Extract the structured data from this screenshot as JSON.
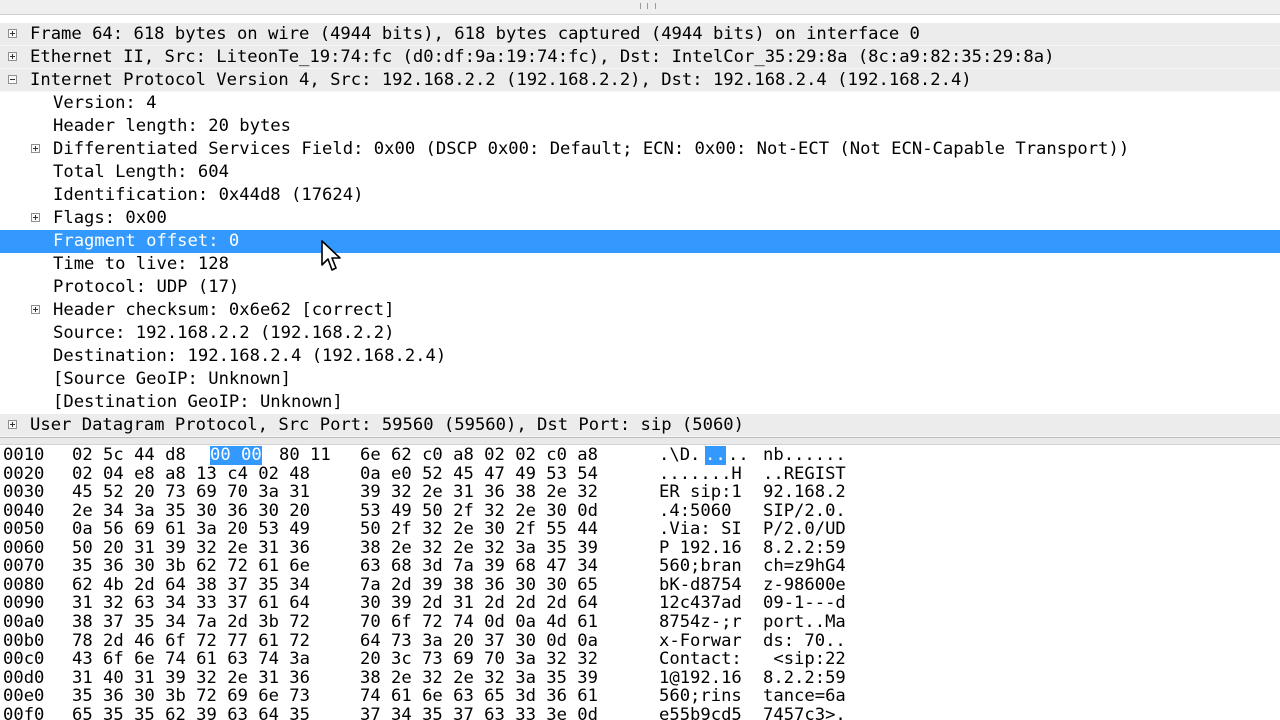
{
  "tree": {
    "rows": [
      {
        "label": "Frame 64: 618 bytes on wire (4944 bits), 618 bytes captured (4944 bits) on interface 0",
        "level": 0,
        "expander": "plus"
      },
      {
        "label": "Ethernet II, Src: LiteonTe_19:74:fc (d0:df:9a:19:74:fc), Dst: IntelCor_35:29:8a (8c:a9:82:35:29:8a)",
        "level": 0,
        "expander": "plus"
      },
      {
        "label": "Internet Protocol Version 4, Src: 192.168.2.2 (192.168.2.2), Dst: 192.168.2.4 (192.168.2.4)",
        "level": 0,
        "expander": "minus"
      },
      {
        "label": "Version: 4",
        "level": 1,
        "expander": "none"
      },
      {
        "label": "Header length: 20 bytes",
        "level": 1,
        "expander": "none"
      },
      {
        "label": "Differentiated Services Field: 0x00 (DSCP 0x00: Default; ECN: 0x00: Not-ECT (Not ECN-Capable Transport))",
        "level": 1,
        "expander": "plus"
      },
      {
        "label": "Total Length: 604",
        "level": 1,
        "expander": "none"
      },
      {
        "label": "Identification: 0x44d8 (17624)",
        "level": 1,
        "expander": "none"
      },
      {
        "label": "Flags: 0x00",
        "level": 1,
        "expander": "plus"
      },
      {
        "label": "Fragment offset: 0",
        "level": 1,
        "expander": "none",
        "selected": true
      },
      {
        "label": "Time to live: 128",
        "level": 1,
        "expander": "none"
      },
      {
        "label": "Protocol: UDP (17)",
        "level": 1,
        "expander": "none"
      },
      {
        "label": "Header checksum: 0x6e62 [correct]",
        "level": 1,
        "expander": "plus"
      },
      {
        "label": "Source: 192.168.2.2 (192.168.2.2)",
        "level": 1,
        "expander": "none"
      },
      {
        "label": "Destination: 192.168.2.4 (192.168.2.4)",
        "level": 1,
        "expander": "none"
      },
      {
        "label": "[Source GeoIP: Unknown]",
        "level": 1,
        "expander": "none"
      },
      {
        "label": "[Destination GeoIP: Unknown]",
        "level": 1,
        "expander": "none"
      },
      {
        "label": "User Datagram Protocol, Src Port: 59560 (59560), Dst Port: sip (5060)",
        "level": 0,
        "expander": "plus"
      }
    ]
  },
  "hex": {
    "rows": [
      {
        "offset": "0010",
        "bytes_a": "02 5c 44 d8",
        "bytes_hl": "00 00",
        "bytes_b": "80 11",
        "bytes_c": "6e 62 c0 a8 02 02 c0 a8",
        "ascii_a": ".\\D.",
        "ascii_hl": "..",
        "ascii_b": "..",
        "ascii_c": "nb......"
      },
      {
        "offset": "0020",
        "bytes_a": "02 04 e8 a8 13 c4 02 48",
        "bytes_c": "0a e0 52 45 47 49 53 54",
        "ascii_a": ".......H",
        "ascii_c": "..REGIST"
      },
      {
        "offset": "0030",
        "bytes_a": "45 52 20 73 69 70 3a 31",
        "bytes_c": "39 32 2e 31 36 38 2e 32",
        "ascii_a": "ER sip:1",
        "ascii_c": "92.168.2"
      },
      {
        "offset": "0040",
        "bytes_a": "2e 34 3a 35 30 36 30 20",
        "bytes_c": "53 49 50 2f 32 2e 30 0d",
        "ascii_a": ".4:5060 ",
        "ascii_c": "SIP/2.0."
      },
      {
        "offset": "0050",
        "bytes_a": "0a 56 69 61 3a 20 53 49",
        "bytes_c": "50 2f 32 2e 30 2f 55 44",
        "ascii_a": ".Via: SI",
        "ascii_c": "P/2.0/UD"
      },
      {
        "offset": "0060",
        "bytes_a": "50 20 31 39 32 2e 31 36",
        "bytes_c": "38 2e 32 2e 32 3a 35 39",
        "ascii_a": "P 192.16",
        "ascii_c": "8.2.2:59"
      },
      {
        "offset": "0070",
        "bytes_a": "35 36 30 3b 62 72 61 6e",
        "bytes_c": "63 68 3d 7a 39 68 47 34",
        "ascii_a": "560;bran",
        "ascii_c": "ch=z9hG4"
      },
      {
        "offset": "0080",
        "bytes_a": "62 4b 2d 64 38 37 35 34",
        "bytes_c": "7a 2d 39 38 36 30 30 65",
        "ascii_a": "bK-d8754",
        "ascii_c": "z-98600e"
      },
      {
        "offset": "0090",
        "bytes_a": "31 32 63 34 33 37 61 64",
        "bytes_c": "30 39 2d 31 2d 2d 2d 64",
        "ascii_a": "12c437ad",
        "ascii_c": "09-1---d"
      },
      {
        "offset": "00a0",
        "bytes_a": "38 37 35 34 7a 2d 3b 72",
        "bytes_c": "70 6f 72 74 0d 0a 4d 61",
        "ascii_a": "8754z-;r",
        "ascii_c": "port..Ma"
      },
      {
        "offset": "00b0",
        "bytes_a": "78 2d 46 6f 72 77 61 72",
        "bytes_c": "64 73 3a 20 37 30 0d 0a",
        "ascii_a": "x-Forwar",
        "ascii_c": "ds: 70.."
      },
      {
        "offset": "00c0",
        "bytes_a": "43 6f 6e 74 61 63 74 3a",
        "bytes_c": "20 3c 73 69 70 3a 32 32",
        "ascii_a": "Contact:",
        "ascii_c": " <sip:22"
      },
      {
        "offset": "00d0",
        "bytes_a": "31 40 31 39 32 2e 31 36",
        "bytes_c": "38 2e 32 2e 32 3a 35 39",
        "ascii_a": "1@192.16",
        "ascii_c": "8.2.2:59"
      },
      {
        "offset": "00e0",
        "bytes_a": "35 36 30 3b 72 69 6e 73",
        "bytes_c": "74 61 6e 63 65 3d 36 61",
        "ascii_a": "560;rins",
        "ascii_c": "tance=6a"
      },
      {
        "offset": "00f0",
        "bytes_a": "65 35 35 62 39 63 64 35",
        "bytes_c": "37 34 35 37 63 33 3e 0d",
        "ascii_a": "e55b9cd5",
        "ascii_c": "7457c3>."
      }
    ]
  },
  "colors": {
    "selection": "#3399ff",
    "top_level_row": "#ececec"
  },
  "icons": {
    "expander_plus": "plus-box-icon",
    "expander_minus": "minus-box-icon",
    "cursor": "mouse-pointer-icon"
  }
}
